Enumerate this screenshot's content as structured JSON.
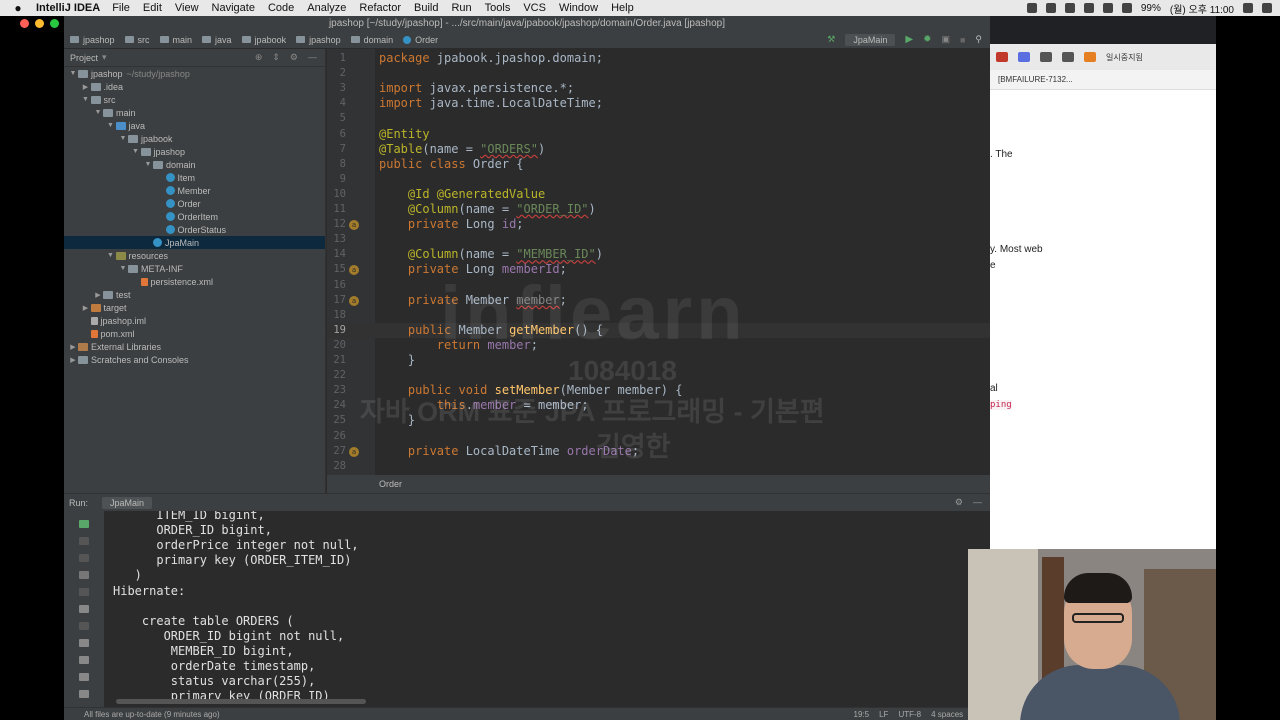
{
  "menubar": {
    "app": "IntelliJ IDEA",
    "menus": [
      "File",
      "Edit",
      "View",
      "Navigate",
      "Code",
      "Analyze",
      "Refactor",
      "Build",
      "Run",
      "Tools",
      "VCS",
      "Window",
      "Help"
    ],
    "battery": "99%",
    "clock": "(월) 오후 11:00"
  },
  "window": {
    "title": "jpashop [~/study/jpashop] - .../src/main/java/jpabook/jpashop/domain/Order.java [jpashop]"
  },
  "breadcrumbs": [
    "jpashop",
    "src",
    "main",
    "java",
    "jpabook",
    "jpashop",
    "domain",
    "Order"
  ],
  "toolbar": {
    "run_config": "JpaMain"
  },
  "project": {
    "header": "Project",
    "tree": [
      {
        "label": "jpashop",
        "sub": "~/study/jpashop",
        "icon": "folder",
        "depth": 0,
        "arrow": "▼"
      },
      {
        "label": ".idea",
        "icon": "folder",
        "depth": 1,
        "arrow": "▶"
      },
      {
        "label": "src",
        "icon": "folder",
        "depth": 1,
        "arrow": "▼"
      },
      {
        "label": "main",
        "icon": "folder",
        "depth": 2,
        "arrow": "▼"
      },
      {
        "label": "java",
        "icon": "src",
        "depth": 3,
        "arrow": "▼"
      },
      {
        "label": "jpabook",
        "icon": "folder",
        "depth": 4,
        "arrow": "▼"
      },
      {
        "label": "jpashop",
        "icon": "folder",
        "depth": 5,
        "arrow": "▼"
      },
      {
        "label": "domain",
        "icon": "folder",
        "depth": 6,
        "arrow": "▼"
      },
      {
        "label": "Item",
        "icon": "cls",
        "depth": 7,
        "arrow": ""
      },
      {
        "label": "Member",
        "icon": "cls",
        "depth": 7,
        "arrow": ""
      },
      {
        "label": "Order",
        "icon": "cls",
        "depth": 7,
        "arrow": ""
      },
      {
        "label": "OrderItem",
        "icon": "cls",
        "depth": 7,
        "arrow": ""
      },
      {
        "label": "OrderStatus",
        "icon": "cls",
        "depth": 7,
        "arrow": ""
      },
      {
        "label": "JpaMain",
        "icon": "cls",
        "depth": 6,
        "arrow": "",
        "selected": true
      },
      {
        "label": "resources",
        "icon": "res",
        "depth": 3,
        "arrow": "▼"
      },
      {
        "label": "META-INF",
        "icon": "folder",
        "depth": 4,
        "arrow": "▼"
      },
      {
        "label": "persistence.xml",
        "icon": "xml",
        "depth": 5,
        "arrow": ""
      },
      {
        "label": "test",
        "icon": "folder",
        "depth": 2,
        "arrow": "▶"
      },
      {
        "label": "target",
        "icon": "target",
        "depth": 1,
        "arrow": "▶"
      },
      {
        "label": "jpashop.iml",
        "icon": "file",
        "depth": 1,
        "arrow": ""
      },
      {
        "label": "pom.xml",
        "icon": "xml",
        "depth": 1,
        "arrow": ""
      },
      {
        "label": "External Libraries",
        "icon": "lib",
        "depth": 0,
        "arrow": "▶"
      },
      {
        "label": "Scratches and Consoles",
        "icon": "folder",
        "depth": 0,
        "arrow": "▶"
      }
    ]
  },
  "editor": {
    "tab_label": "Order",
    "lines": [
      {
        "n": "1",
        "html": "<span class=\"kw\">package</span> jpabook.jpashop.domain;"
      },
      {
        "n": "2",
        "html": ""
      },
      {
        "n": "3",
        "html": "<span class=\"kw\">import</span> javax.persistence.*;"
      },
      {
        "n": "4",
        "html": "<span class=\"kw\">import</span> java.time.LocalDateTime;"
      },
      {
        "n": "5",
        "html": ""
      },
      {
        "n": "6",
        "html": "<span class=\"an\">@Entity</span>"
      },
      {
        "n": "7",
        "html": "<span class=\"an\">@Table</span>(name = <span class=\"str err\">\"ORDERS\"</span>)"
      },
      {
        "n": "8",
        "html": "<span class=\"kw\">public class</span> Order {"
      },
      {
        "n": "9",
        "html": ""
      },
      {
        "n": "10",
        "html": "    <span class=\"an\">@Id @GeneratedValue</span>"
      },
      {
        "n": "11",
        "html": "    <span class=\"an\">@Column</span>(name = <span class=\"str err\">\"ORDER_ID\"</span>)"
      },
      {
        "n": "12",
        "html": "    <span class=\"kw\">private</span> Long <span class=\"fld\">id</span>;",
        "mark": true
      },
      {
        "n": "13",
        "html": ""
      },
      {
        "n": "14",
        "html": "    <span class=\"an\">@Column</span>(name = <span class=\"str err\">\"MEMBER_ID\"</span>)"
      },
      {
        "n": "15",
        "html": "    <span class=\"kw\">private</span> Long <span class=\"fld\">memberId</span>;",
        "mark": true
      },
      {
        "n": "16",
        "html": ""
      },
      {
        "n": "17",
        "html": "    <span class=\"kw\">private</span> Member <span class=\"fld gray err\">member</span>;",
        "mark": true
      },
      {
        "n": "18",
        "html": ""
      },
      {
        "n": "19",
        "html": "    <span class=\"kw\">public</span> Member <span class=\"mtd\">getMember</span>() {",
        "current": true
      },
      {
        "n": "20",
        "html": "        <span class=\"kw\">return</span> <span class=\"fld\">member</span>;"
      },
      {
        "n": "21",
        "html": "    }"
      },
      {
        "n": "22",
        "html": ""
      },
      {
        "n": "23",
        "html": "    <span class=\"kw\">public void</span> <span class=\"mtd\">setMember</span>(Member member) {"
      },
      {
        "n": "24",
        "html": "        <span class=\"kw\">this</span>.<span class=\"fld\">member</span> = member;"
      },
      {
        "n": "25",
        "html": "    }"
      },
      {
        "n": "26",
        "html": ""
      },
      {
        "n": "27",
        "html": "    <span class=\"kw\">private</span> LocalDateTime <span class=\"fld\">orderDate</span>;",
        "mark": true
      },
      {
        "n": "28",
        "html": ""
      }
    ]
  },
  "watermark": {
    "logo": "inflearn",
    "id": "1084018",
    "course": "자바 ORM 표준 JPA 프로그래밍 - 기본편",
    "name": "김영한"
  },
  "run": {
    "label": "Run:",
    "tab": "JpaMain",
    "console": [
      "      ITEM_ID bigint,",
      "      ORDER_ID bigint,",
      "      orderPrice integer not null,",
      "      primary key (ORDER_ITEM_ID)",
      "   )",
      "Hibernate: ",
      "",
      "    create table ORDERS (",
      "       ORDER_ID bigint not null,",
      "        MEMBER_ID bigint,",
      "        orderDate timestamp,",
      "        status varchar(255),",
      "        primary key (ORDER_ID)"
    ]
  },
  "status": {
    "message": "All files are up-to-date (9 minutes ago)",
    "position": "19:5",
    "line_sep": "LF",
    "encoding": "UTF-8",
    "indent": "4 spaces"
  },
  "browser": {
    "tab_title": "[BMFAILURE-7132...",
    "profile": "일시중지됨",
    "snippets": [
      ". The",
      "y. Most web",
      "e",
      "al"
    ],
    "code_snippet": "ping"
  }
}
